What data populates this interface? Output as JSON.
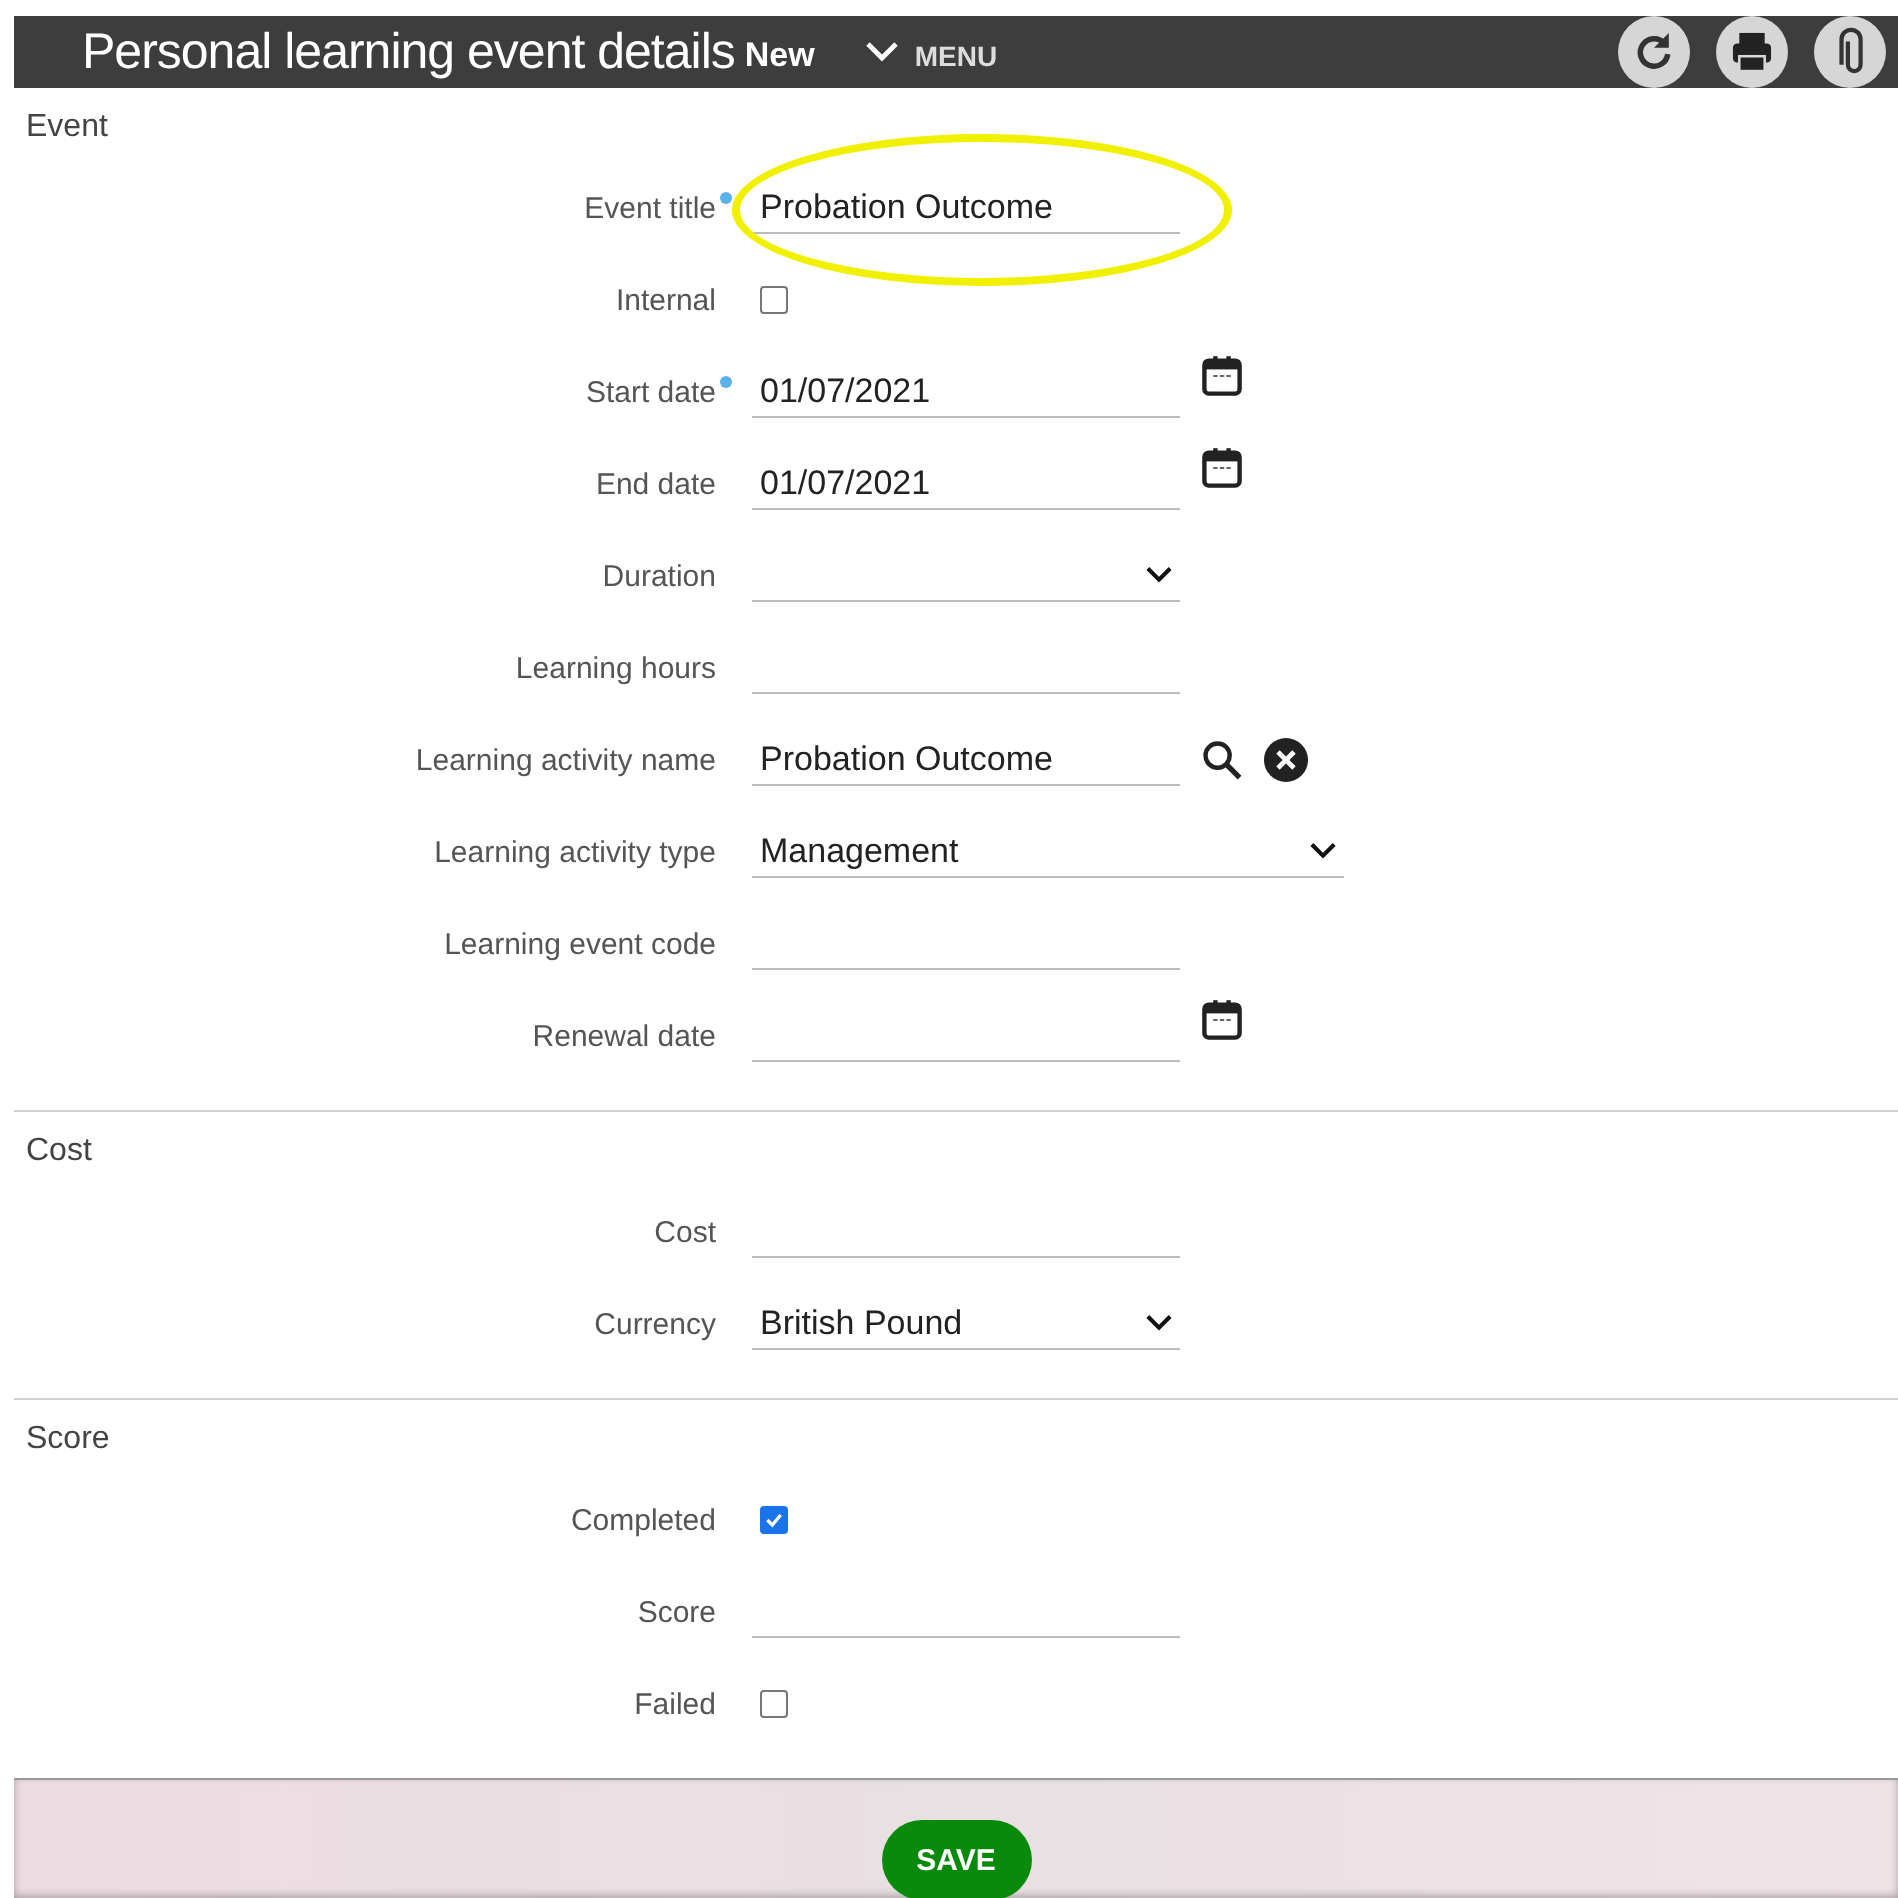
{
  "header": {
    "title": "Personal learning event details",
    "status": "New",
    "menu": "MENU"
  },
  "sections": [
    {
      "title": "Event",
      "fields": [
        {
          "kind": "text",
          "label": "Event title",
          "required": true,
          "value": "Probation Outcome",
          "highlighted": true
        },
        {
          "kind": "checkbox",
          "label": "Internal",
          "checked": false
        },
        {
          "kind": "date",
          "label": "Start date",
          "required": true,
          "value": "01/07/2021"
        },
        {
          "kind": "date",
          "label": "End date",
          "value": "01/07/2021"
        },
        {
          "kind": "select",
          "label": "Duration"
        },
        {
          "kind": "text",
          "label": "Learning hours"
        },
        {
          "kind": "lookup",
          "label": "Learning activity name",
          "value": "Probation Outcome"
        },
        {
          "kind": "wideselect",
          "label": "Learning activity type",
          "value": "Management"
        },
        {
          "kind": "text",
          "label": "Learning event code"
        },
        {
          "kind": "date",
          "label": "Renewal date"
        }
      ]
    },
    {
      "title": "Cost",
      "fields": [
        {
          "kind": "text",
          "label": "Cost"
        },
        {
          "kind": "select",
          "label": "Currency",
          "value": "British Pound"
        }
      ]
    },
    {
      "title": "Score",
      "fields": [
        {
          "kind": "checkbox",
          "label": "Completed",
          "checked": true
        },
        {
          "kind": "text",
          "label": "Score"
        },
        {
          "kind": "checkbox",
          "label": "Failed",
          "checked": false
        }
      ]
    }
  ],
  "save_button": "SAVE"
}
